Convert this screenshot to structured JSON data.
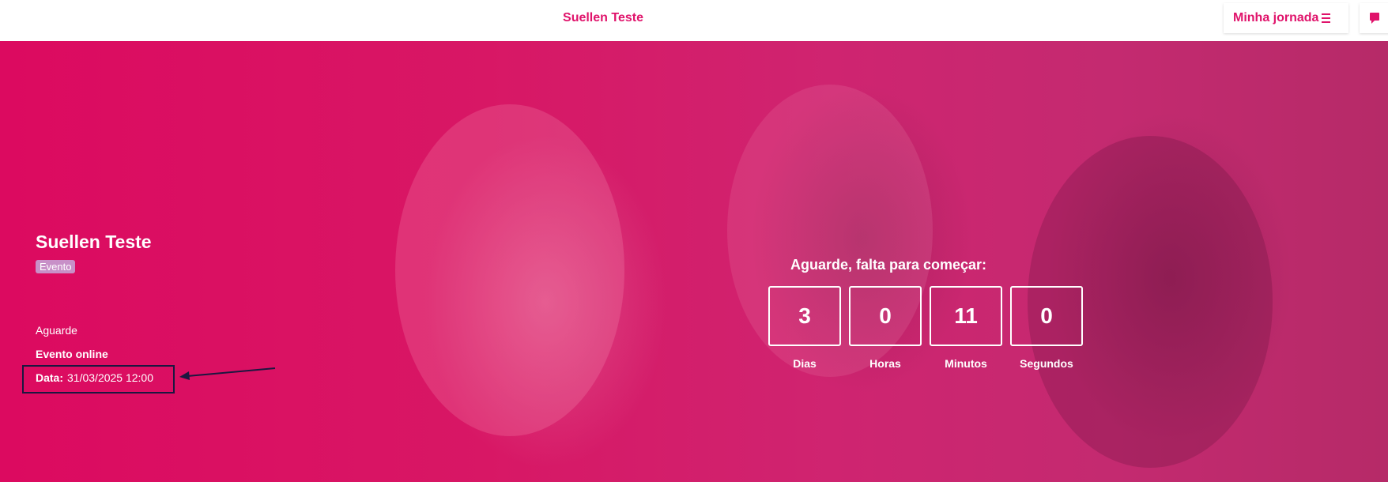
{
  "header": {
    "title": "Suellen Teste",
    "journey_label": "Minha jornada",
    "menu_icon": "hamburger-menu-icon",
    "chat_icon": "chat-icon"
  },
  "event": {
    "name": "Suellen Teste",
    "tag": "Evento",
    "status": "Aguarde",
    "type": "Evento online",
    "date_label": "Data:",
    "date_value": "31/03/2025 12:00"
  },
  "countdown": {
    "title": "Aguarde, falta para começar:",
    "units": [
      {
        "value": "3",
        "label": "Dias"
      },
      {
        "value": "0",
        "label": "Horas"
      },
      {
        "value": "11",
        "label": "Minutos"
      },
      {
        "value": "0",
        "label": "Segundos"
      }
    ]
  },
  "colors": {
    "brand": "#e0136b",
    "annotation": "#1b1740"
  }
}
